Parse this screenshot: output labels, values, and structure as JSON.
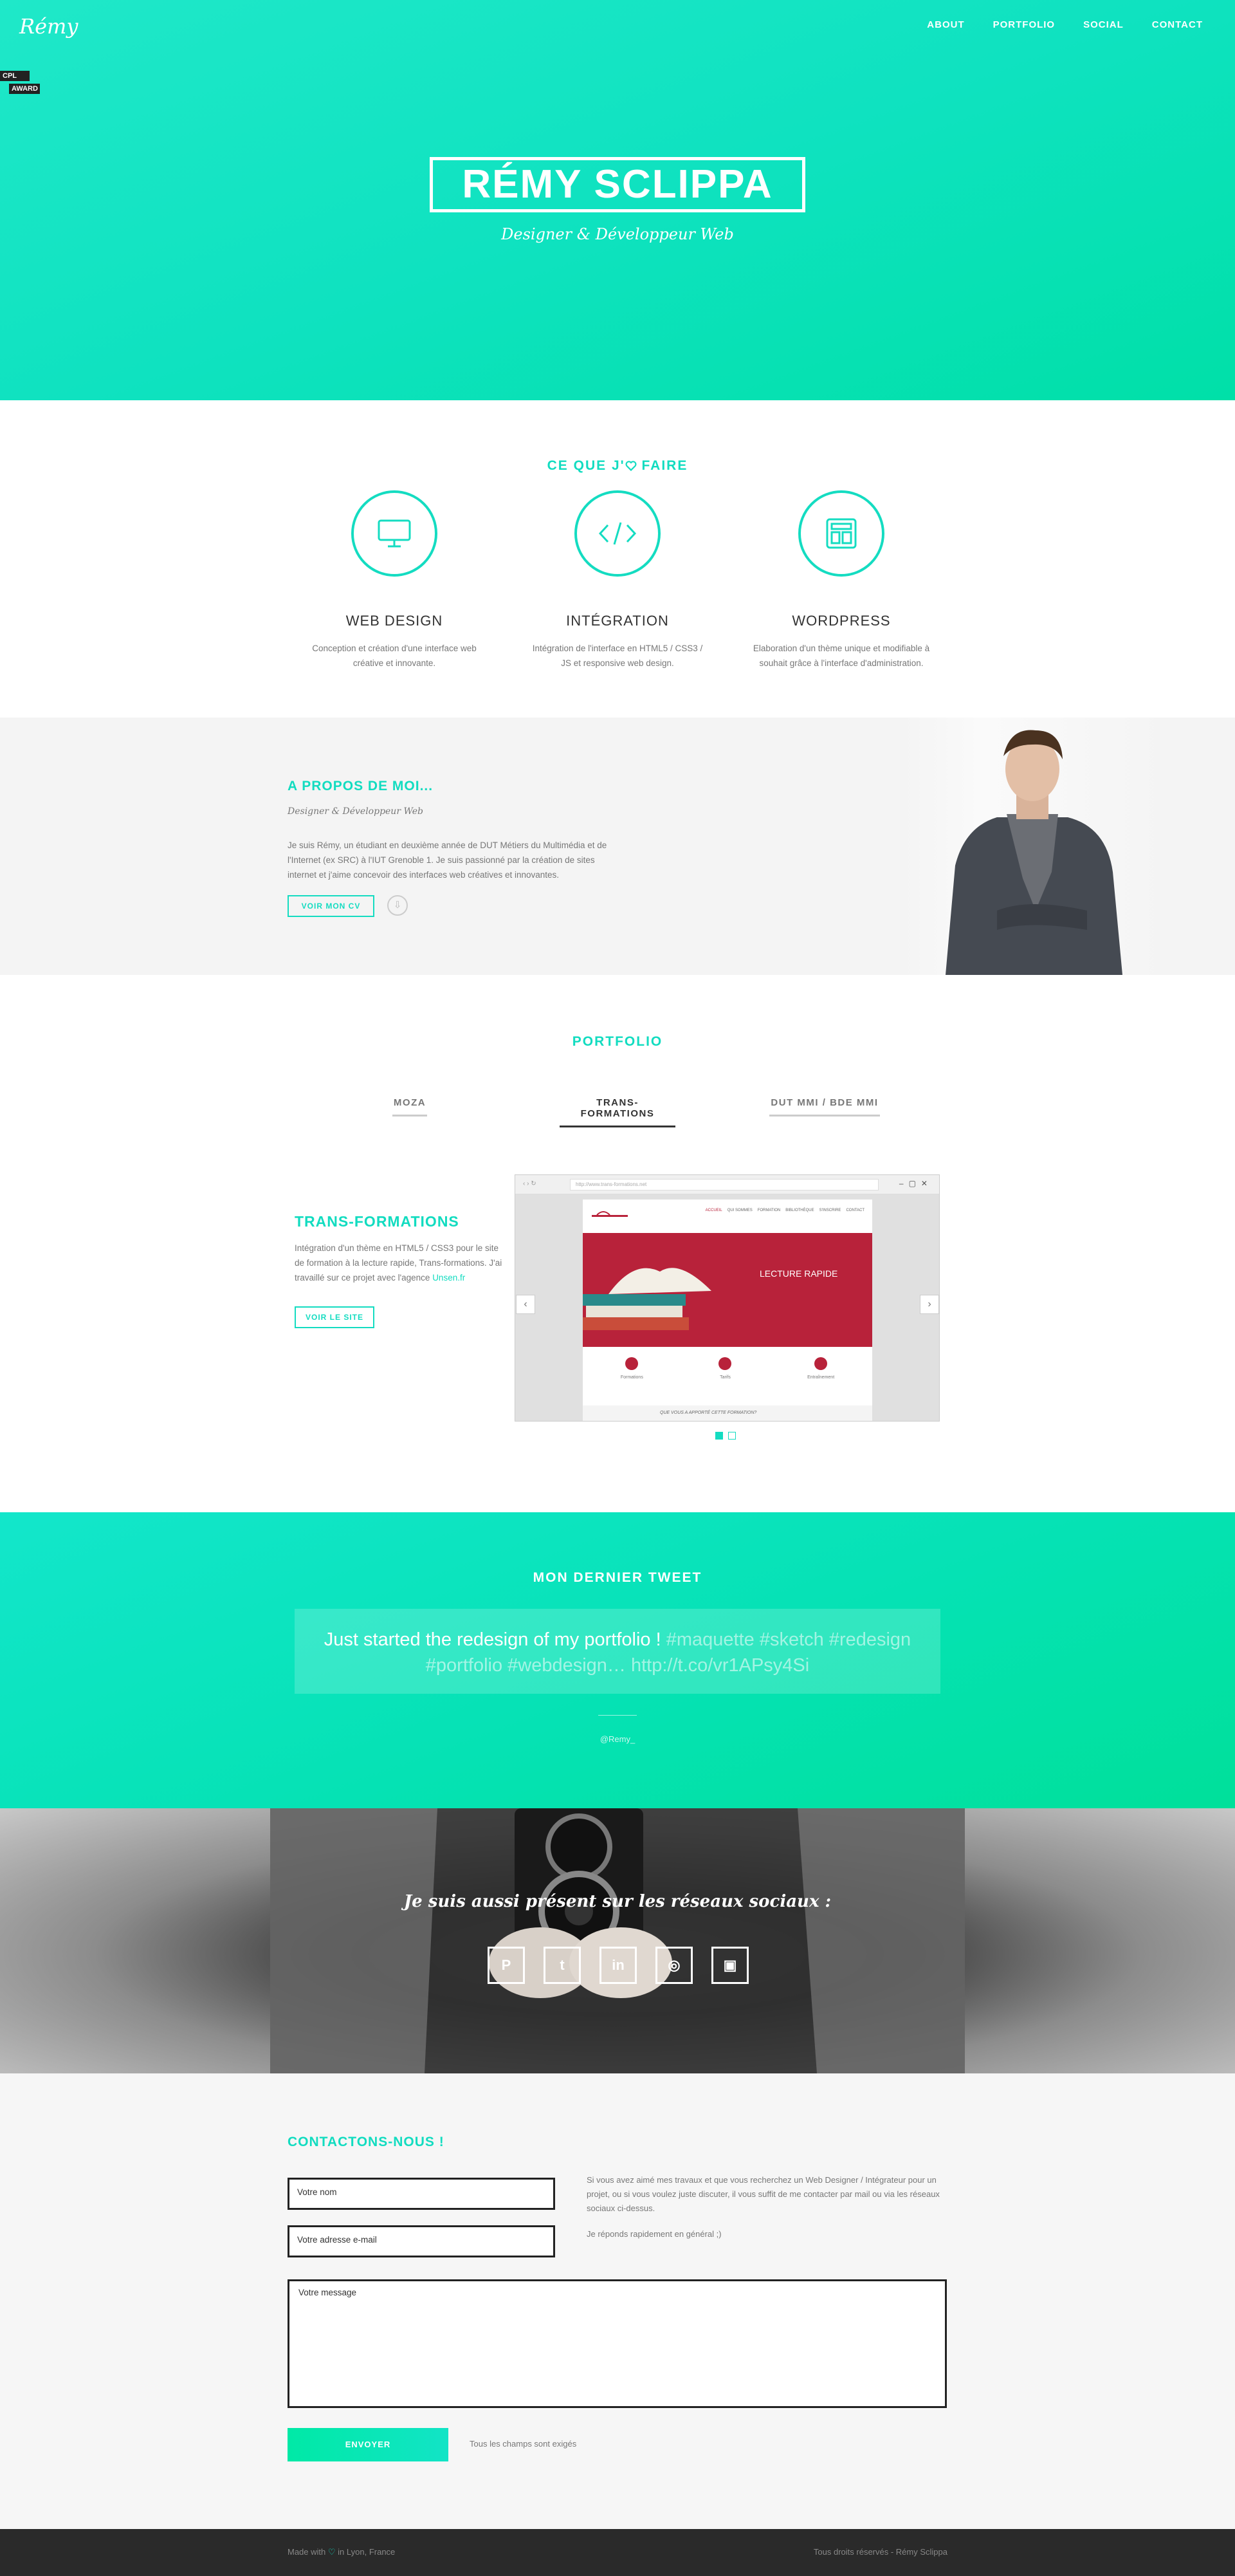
{
  "header": {
    "logo": "Rémy",
    "nav": [
      "ABOUT",
      "PORTFOLIO",
      "SOCIAL",
      "CONTACT"
    ],
    "award": [
      "CPL",
      "AWARD"
    ]
  },
  "hero": {
    "title": "RÉMY SCLIPPA",
    "subtitle": "Designer & Développeur Web"
  },
  "services": {
    "title_before": "CE QUE J'",
    "title_after": " FAIRE",
    "items": [
      {
        "icon": "monitor-icon",
        "title": "WEB DESIGN",
        "text": "Conception et création d'une interface web créative et innovante."
      },
      {
        "icon": "code-icon",
        "title": "INTÉGRATION",
        "text": "Intégration de l'interface en HTML5 / CSS3 / JS et responsive web design."
      },
      {
        "icon": "layout-icon",
        "title": "WORDPRESS",
        "text": "Elaboration d'un thème unique et modifiable à souhait grâce à l'interface d'administration."
      }
    ]
  },
  "about": {
    "title": "A PROPOS DE MOI...",
    "subtitle": "Designer & Développeur Web",
    "text": "Je suis Rémy, un étudiant en deuxième année de DUT Métiers du Multimédia et de l'Internet (ex SRC) à l'IUT Grenoble 1. Je suis passionné par la création de sites internet et j'aime concevoir des interfaces web créatives et innovantes.",
    "cv_button": "VOIR MON CV"
  },
  "portfolio": {
    "title": "PORTFOLIO",
    "tabs": [
      "MOZA",
      "TRANS-FORMATIONS",
      "DUT MMI / BDE MMI"
    ],
    "project": {
      "title": "TRANS-FORMATIONS",
      "text": "Intégration d'un thème en HTML5 / CSS3 pour le site de formation à la lecture rapide, Trans-formations. J'ai travaillé sur ce projet avec l'agence ",
      "link": "Unsen.fr",
      "button": "VOIR LE SITE"
    },
    "browser": {
      "url": "http://www.trans-formations.net",
      "banner": "LECTURE RAPIDE",
      "menu": [
        "ACCUEIL",
        "QUI SOMMES",
        "FORMATION",
        "BIBLIOTHÈQUE",
        "S'INSCRIRE",
        "CONTACT"
      ],
      "features": [
        "Formations",
        "Tarifs",
        "Entraînement"
      ],
      "footer_question": "QUE VOUS A APPORTÉ CETTE FORMATION?"
    }
  },
  "tweet": {
    "title": "MON DERNIER TWEET",
    "text": "Just started the redesign of my portfolio ! ",
    "tags": "#maquette #sketch #redesign #portfolio #webdesign… http://t.co/vr1APsy4Si",
    "handle": "@Remy_"
  },
  "social": {
    "quote": "Je suis aussi présent sur les réseaux sociaux :",
    "networks": [
      "pinterest-icon",
      "twitter-icon",
      "linkedin-icon",
      "dribbble-icon",
      "instagram-icon"
    ]
  },
  "contact": {
    "title": "CONTACTONS-NOUS !",
    "name_placeholder": "Votre nom",
    "email_placeholder": "Votre adresse e-mail",
    "message_placeholder": "Votre message",
    "info": "Si vous avez aimé mes travaux et que vous recherchez un Web Designer / Intégrateur pour un projet, ou si vous voulez juste discuter, il vous suffit de me contacter par mail ou via les réseaux sociaux ci-dessus.",
    "info2": "Je réponds rapidement en général ;)",
    "send": "ENVOYER",
    "required": "Tous les champs sont exigés"
  },
  "footer": {
    "made_with": "Made with",
    "location": "in Lyon, France",
    "rights": "Tous droits réservés - Rémy Sclippa"
  }
}
